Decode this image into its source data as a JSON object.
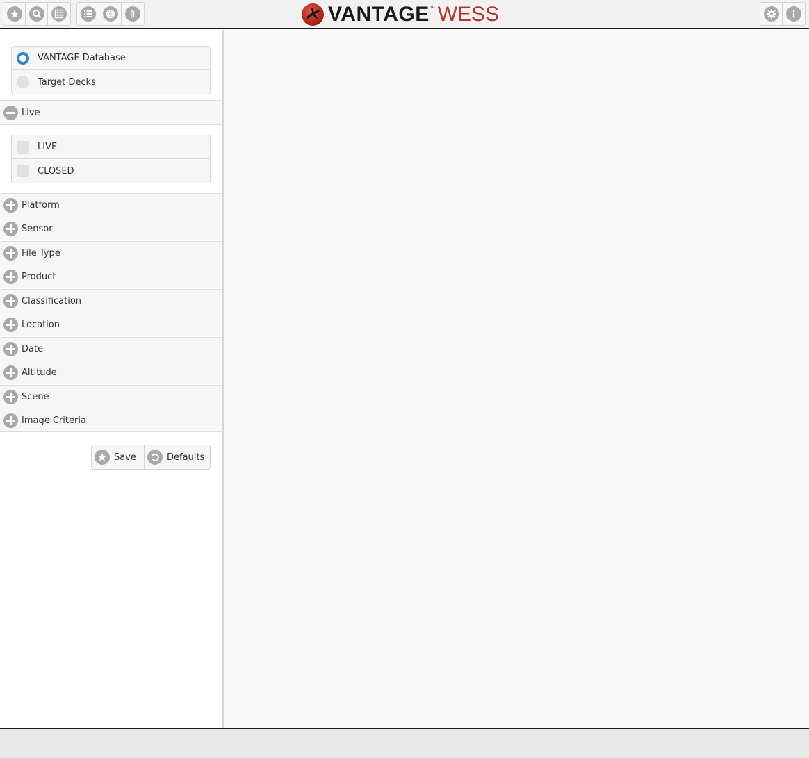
{
  "header": {
    "left_tools": [
      {
        "icon": "star-icon"
      },
      {
        "icon": "search-icon"
      },
      {
        "icon": "grid-icon"
      }
    ],
    "mid_tools": [
      {
        "icon": "list-icon"
      },
      {
        "icon": "globe-icon"
      },
      {
        "icon": "clip-icon"
      }
    ],
    "right_tools": [
      {
        "icon": "gear-icon"
      },
      {
        "icon": "info-icon"
      }
    ],
    "logo": {
      "name": "VANTAGE",
      "tm": "™",
      "suffix": "WESS"
    }
  },
  "source": {
    "options": [
      {
        "label": "VANTAGE Database",
        "selected": true
      },
      {
        "label": "Target Decks",
        "selected": false
      }
    ]
  },
  "live": {
    "label": "Live",
    "expanded": true,
    "options": [
      {
        "label": "LIVE",
        "checked": false
      },
      {
        "label": "CLOSED",
        "checked": false
      }
    ]
  },
  "sections": [
    {
      "label": "Platform"
    },
    {
      "label": "Sensor"
    },
    {
      "label": "File Type"
    },
    {
      "label": "Product"
    },
    {
      "label": "Classification"
    },
    {
      "label": "Location"
    },
    {
      "label": "Date"
    },
    {
      "label": "Altitude"
    },
    {
      "label": "Scene"
    },
    {
      "label": "Image Criteria"
    }
  ],
  "actions": {
    "save_label": "Save",
    "defaults_label": "Defaults"
  },
  "colors": {
    "accent": "#3388cc",
    "brand_red": "#b3362c",
    "icon_gray": "#a9a9a9"
  }
}
